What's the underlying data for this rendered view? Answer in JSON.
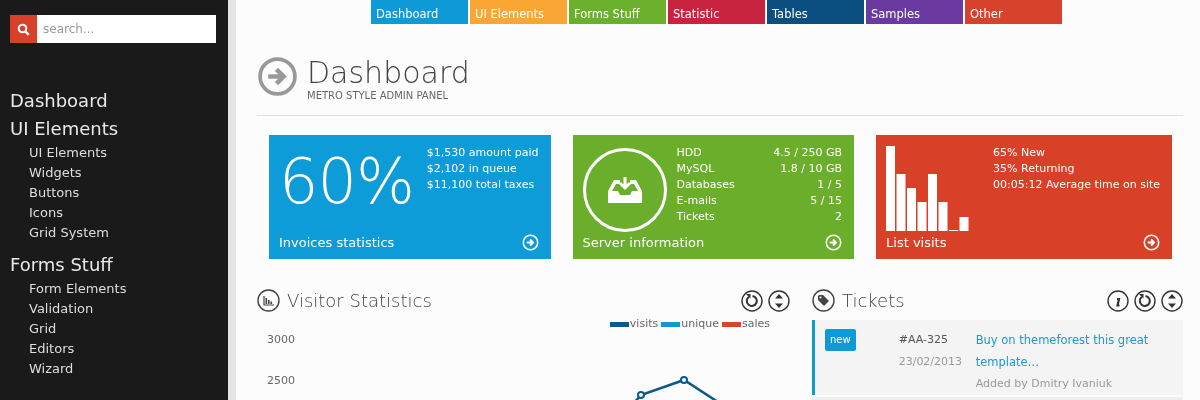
{
  "sidebar": {
    "search": {
      "placeholder": "search..."
    },
    "nav": [
      {
        "label": "Dashboard"
      },
      {
        "label": "UI Elements",
        "children": [
          {
            "label": "UI Elements"
          },
          {
            "label": "Widgets"
          },
          {
            "label": "Buttons"
          },
          {
            "label": "Icons"
          },
          {
            "label": "Grid System"
          }
        ]
      },
      {
        "label": "Forms Stuff",
        "children": [
          {
            "label": "Form Elements"
          },
          {
            "label": "Validation"
          },
          {
            "label": "Grid"
          },
          {
            "label": "Editors"
          },
          {
            "label": "Wizard"
          }
        ]
      }
    ]
  },
  "top_nav": [
    {
      "label": "Dashboard",
      "color": "#0e9ad7"
    },
    {
      "label": "UI Elements",
      "color": "#f9a634"
    },
    {
      "label": "Forms Stuff",
      "color": "#6ab02c"
    },
    {
      "label": "Statistic",
      "color": "#c8233f"
    },
    {
      "label": "Tables",
      "color": "#0a4f80"
    },
    {
      "label": "Samples",
      "color": "#6b3aa0"
    },
    {
      "label": "Other",
      "color": "#d6422b"
    }
  ],
  "header": {
    "title": "Dashboard",
    "subtitle": "METRO STYLE ADMIN PANEL"
  },
  "tiles": [
    {
      "kind": "percent",
      "color": "#0d9cd8",
      "value": "60%",
      "lines": [
        "$1,530 amount paid",
        "$2,102 in queue",
        "$11,100 total taxes"
      ],
      "footer": "Invoices statistics"
    },
    {
      "kind": "server",
      "color": "#6aae2c",
      "rows": [
        {
          "name": "HDD",
          "value": "4.5 / 250 GB"
        },
        {
          "name": "MySQL",
          "value": "1.8 / 10 GB"
        },
        {
          "name": "Databases",
          "value": "1 / 5"
        },
        {
          "name": "E-mails",
          "value": "5 / 15"
        },
        {
          "name": "Tickets",
          "value": "2"
        }
      ],
      "footer": "Server information"
    },
    {
      "kind": "visits",
      "color": "#d84128",
      "lines": [
        "65% New",
        "35% Returning",
        "00:05:12 Average time on site"
      ],
      "footer": "List visits"
    }
  ],
  "visitor_statistics": {
    "title": "Visitor Statistics",
    "legend": [
      {
        "name": "visits",
        "color": "#0b5a8a"
      },
      {
        "name": "unique",
        "color": "#1596d3"
      },
      {
        "name": "sales",
        "color": "#d8432b"
      }
    ],
    "y_labels": [
      "3000",
      "2500"
    ]
  },
  "tickets": {
    "title": "Tickets",
    "items": [
      {
        "badge": "new",
        "id": "#AA-325",
        "date": "23/02/2013",
        "title": "Buy on themeforest this great template…",
        "author": "Added by Dmitry Ivaniuk"
      }
    ]
  }
}
